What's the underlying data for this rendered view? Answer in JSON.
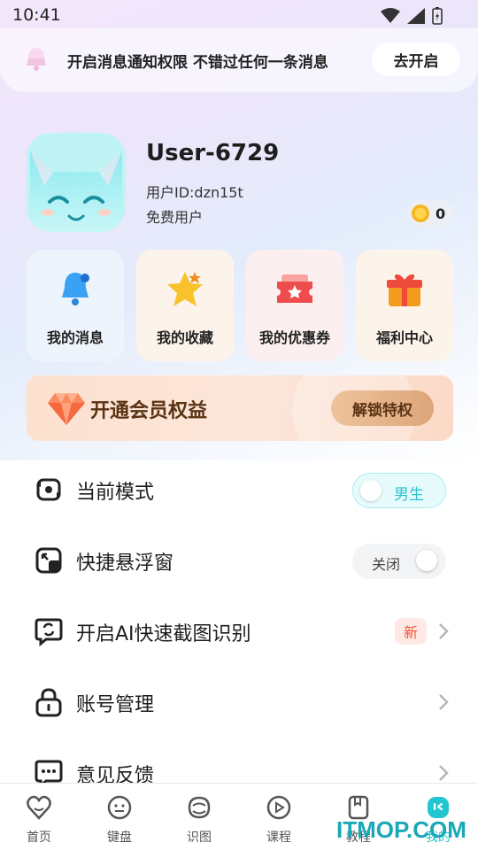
{
  "status_bar": {
    "time": "10:41"
  },
  "banner": {
    "text": "开启消息通知权限 不错过任何一条消息",
    "button_label": "去开启"
  },
  "profile": {
    "username": "User-6729",
    "user_id": "用户ID:dzn15t",
    "user_type": "免费用户",
    "coins": "0"
  },
  "quick_cards": [
    {
      "label": "我的消息",
      "icon": "bell-icon",
      "bg": "#eef4fc"
    },
    {
      "label": "我的收藏",
      "icon": "star-icon",
      "bg": "#fcf4ea"
    },
    {
      "label": "我的优惠券",
      "icon": "coupon-icon",
      "bg": "#fcefef"
    },
    {
      "label": "福利中心",
      "icon": "gift-icon",
      "bg": "#fcf4ea"
    }
  ],
  "vip": {
    "title": "开通会员权益",
    "button_label": "解锁特权"
  },
  "settings": {
    "mode": {
      "label": "当前模式",
      "toggle_value": "男生"
    },
    "float_window": {
      "label": "快捷悬浮窗",
      "toggle_value": "关闭"
    },
    "ai_screenshot": {
      "label": "开启AI快速截图识别",
      "badge": "新"
    },
    "account": {
      "label": "账号管理"
    },
    "feedback": {
      "label": "意见反馈"
    }
  },
  "bottom_nav": [
    {
      "label": "首页",
      "icon": "heart-home-icon"
    },
    {
      "label": "键盘",
      "icon": "keyboard-face-icon"
    },
    {
      "label": "识图",
      "icon": "recognize-icon"
    },
    {
      "label": "课程",
      "icon": "play-icon"
    },
    {
      "label": "教程",
      "icon": "tutorial-icon"
    },
    {
      "label": "我的",
      "icon": "profile-icon",
      "active": true
    }
  ],
  "watermark": "ITMOP.COM",
  "colors": {
    "accent": "#21c6d1",
    "vip_text": "#5a3314",
    "badge_red": "#f2553a"
  }
}
